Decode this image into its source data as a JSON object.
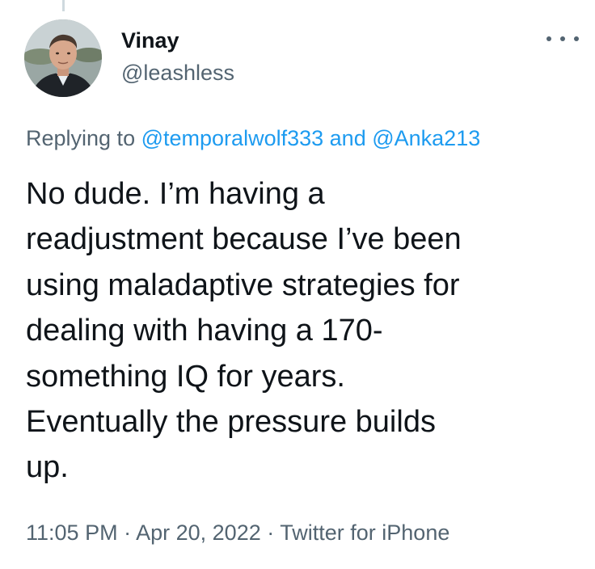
{
  "tweet": {
    "author": {
      "display_name": "Vinay",
      "handle": "@leashless",
      "avatar_icon": "profile-photo"
    },
    "more_icon": "more-horizontal-icon",
    "replying_to": {
      "prefix": "Replying to",
      "mention_1": "@temporalwolf333",
      "conjunction": "and",
      "mention_2": "@Anka213"
    },
    "text_lines": [
      "No dude. I’m having a",
      "readjustment because I’ve been",
      "using maladaptive strategies for",
      "dealing with having a 170-",
      "something IQ for years.",
      "Eventually the pressure builds",
      "up."
    ],
    "time": "11:05 PM",
    "separator": "·",
    "date": "Apr 20, 2022",
    "source": "Twitter for iPhone"
  },
  "colors": {
    "text_primary": "#0f1419",
    "text_secondary": "#536471",
    "link": "#1d9bf0",
    "thread_line": "#cfd9de",
    "background": "#ffffff"
  }
}
